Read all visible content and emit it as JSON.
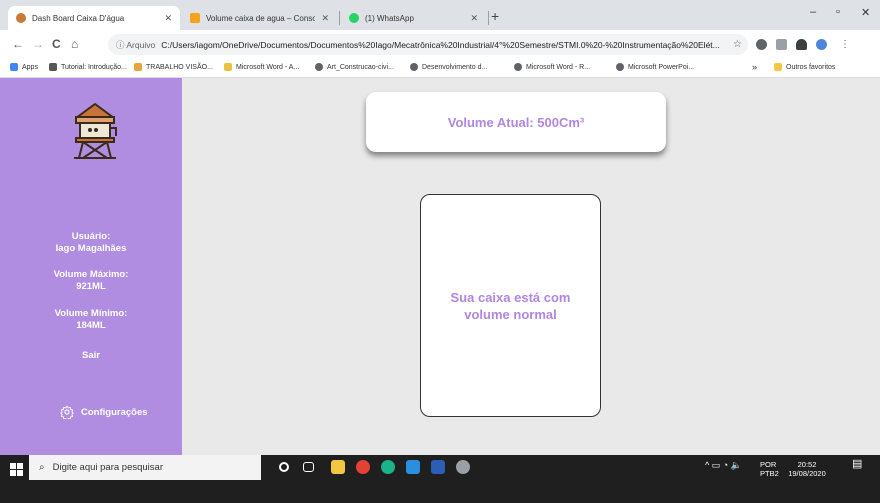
{
  "browser": {
    "tabs": [
      {
        "title": "Dash Board Caixa D'água",
        "active": true
      },
      {
        "title": "Volume caixa de agua – Console",
        "active": false
      },
      {
        "title": "(1) WhatsApp",
        "active": false
      }
    ],
    "new_tab_label": "+",
    "window_controls": {
      "minimize": "–",
      "maximize": "▫",
      "close": "✕"
    },
    "nav": {
      "back": "←",
      "forward": "→",
      "reload": "C",
      "home": "⌂"
    },
    "address": {
      "prefix": "ⓘ Arquivo",
      "url": "C:/Users/iagom/OneDrive/Documentos/Documentos%20Iago/Mecatrônica%20Industrial/4°%20Semestre/STMI.0%20-%20Instrumentação%20Elét..."
    },
    "bookmarks": [
      "Apps",
      "Tutorial: Introdução...",
      "TRABALHO VISÃO...",
      "Microsoft Word - A...",
      "Art_Construcao-civi...",
      "Desenvolvimento d...",
      "Microsoft Word - R...",
      "Microsoft PowerPoi..."
    ],
    "bookmarks_overflow": "»",
    "other_bookmarks": "Outros favoritos"
  },
  "sidebar": {
    "user_label": "Usuário:",
    "user_name": "Iago Magalhães",
    "max_label": "Volume Máximo:",
    "max_value": "921ML",
    "min_label": "Volume Mínimo:",
    "min_value": "184ML",
    "logout": "Sair",
    "settings": "Configurações"
  },
  "main": {
    "current_volume": "Volume Atual: 500Cm³",
    "status_message": "Sua caixa está com volume normal"
  },
  "taskbar": {
    "search_placeholder": "Digite aqui para pesquisar",
    "lang_top": "POR",
    "lang_bottom": "PTB2",
    "time": "20:52",
    "date": "19/08/2020"
  },
  "colors": {
    "accent": "#b086e0",
    "sidebar_bg": "#b08de0",
    "page_bg": "#e9e9e9"
  }
}
